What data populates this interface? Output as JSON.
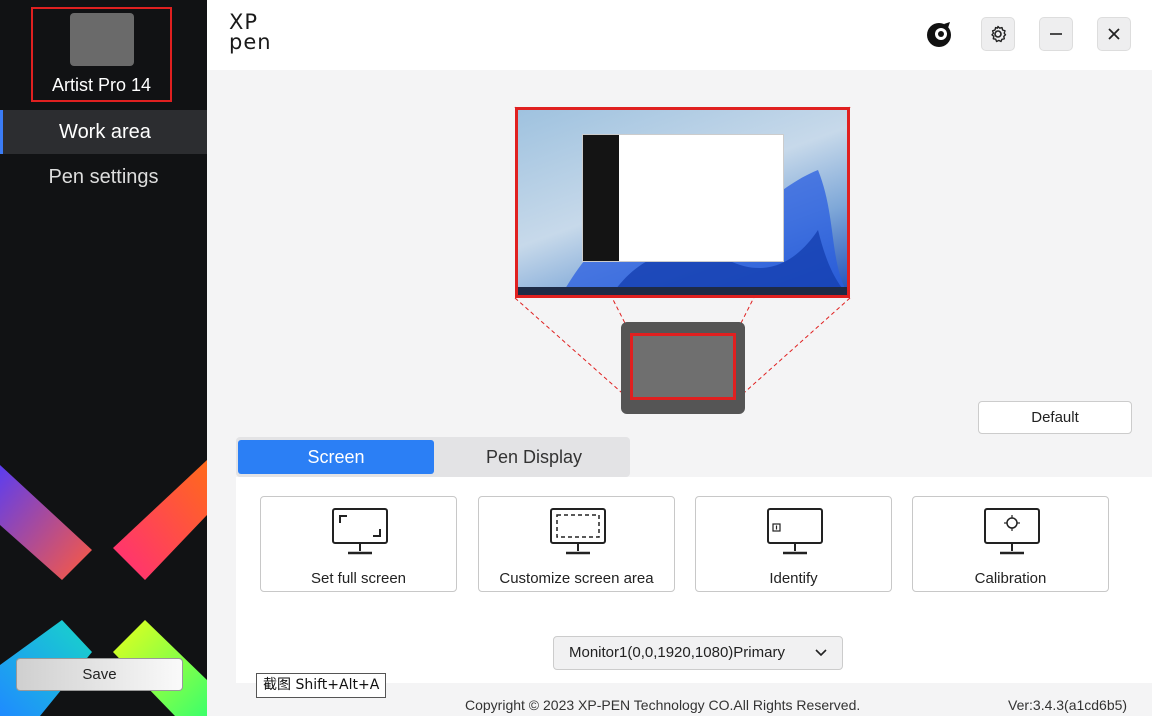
{
  "sidebar": {
    "device_name": "Artist Pro 14",
    "items": [
      {
        "label": "Work area",
        "active": true
      },
      {
        "label": "Pen settings",
        "active": false
      }
    ],
    "save_label": "Save"
  },
  "header": {
    "logo_line1": "XP",
    "logo_line2": "pen",
    "icons": [
      "xp-badge-icon",
      "settings-icon",
      "minimize-icon",
      "close-icon"
    ]
  },
  "preview": {
    "default_label": "Default"
  },
  "tabs": [
    {
      "label": "Screen",
      "active": true
    },
    {
      "label": "Pen Display",
      "active": false
    }
  ],
  "actions": [
    {
      "label": "Set full screen",
      "icon": "full-screen-monitor-icon"
    },
    {
      "label": "Customize screen area",
      "icon": "custom-area-monitor-icon"
    },
    {
      "label": "Identify",
      "icon": "identify-monitor-icon"
    },
    {
      "label": "Calibration",
      "icon": "calibration-monitor-icon"
    }
  ],
  "monitor_select": {
    "value": "Monitor1(0,0,1920,1080)Primary"
  },
  "footer": {
    "copyright": "Copyright © 2023  XP-PEN Technology CO.All Rights Reserved.",
    "version": "Ver:3.4.3(a1cd6b5)"
  },
  "tooltip": "截图 Shift+Alt+A",
  "colors": {
    "accent": "#2b7ff5",
    "highlight": "#e02020",
    "sidebar_bg": "#111214"
  }
}
